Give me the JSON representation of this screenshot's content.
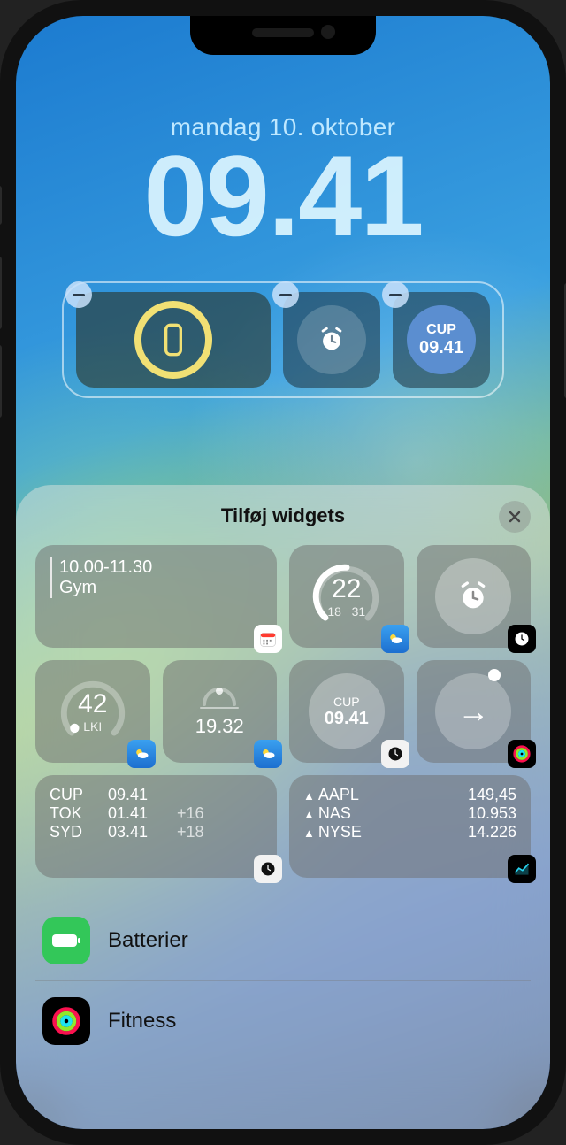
{
  "lock": {
    "date": "mandag 10. oktober",
    "time": "09.41"
  },
  "widget_slots": {
    "cup_label": "CUP",
    "cup_time": "09.41"
  },
  "sheet": {
    "title": "Tilføj widgets"
  },
  "suggestions": {
    "calendar": {
      "time_range": "10.00-11.30",
      "title": "Gym"
    },
    "temperature": {
      "current": "22",
      "low": "18",
      "high": "31"
    },
    "aqi": {
      "value": "42",
      "label": "LKI"
    },
    "sunset": {
      "time": "19.32"
    },
    "world_clock_single": {
      "label": "CUP",
      "time": "09.41"
    },
    "world_clock_list": [
      {
        "city": "CUP",
        "time": "09.41",
        "offset": ""
      },
      {
        "city": "TOK",
        "time": "01.41",
        "offset": "+16"
      },
      {
        "city": "SYD",
        "time": "03.41",
        "offset": "+18"
      }
    ],
    "stocks": [
      {
        "symbol": "AAPL",
        "value": "149,45"
      },
      {
        "symbol": "NAS",
        "value": "10.953"
      },
      {
        "symbol": "NYSE",
        "value": "14.226"
      }
    ]
  },
  "app_list": [
    {
      "name": "Batterier",
      "id": "batteries"
    },
    {
      "name": "Fitness",
      "id": "fitness"
    }
  ]
}
